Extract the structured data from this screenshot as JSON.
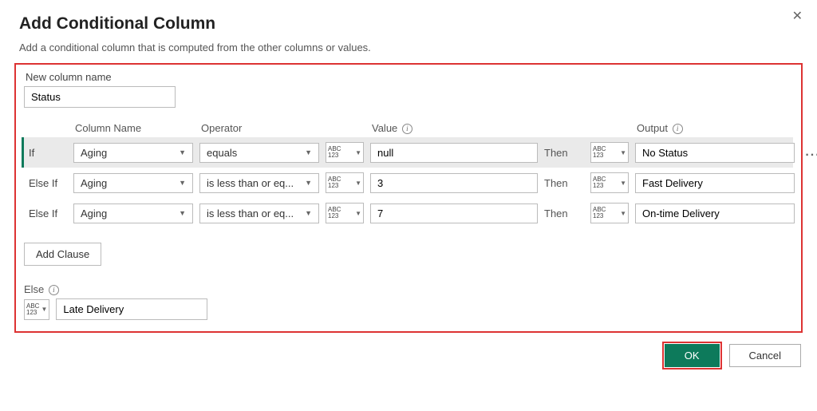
{
  "dialog": {
    "title": "Add Conditional Column",
    "subtitle": "Add a conditional column that is computed from the other columns or values."
  },
  "newColumn": {
    "label": "New column name",
    "value": "Status"
  },
  "headers": {
    "column": "Column Name",
    "operator": "Operator",
    "value": "Value",
    "output": "Output"
  },
  "thenLabel": "Then",
  "typeIcon": "ABC\n123",
  "clauses": [
    {
      "prefix": "If",
      "column": "Aging",
      "operator": "equals",
      "value": "null",
      "output": "No Status",
      "active": true
    },
    {
      "prefix": "Else If",
      "column": "Aging",
      "operator": "is less than or eq...",
      "value": "3",
      "output": "Fast Delivery",
      "active": false
    },
    {
      "prefix": "Else If",
      "column": "Aging",
      "operator": "is less than or eq...",
      "value": "7",
      "output": "On-time Delivery",
      "active": false
    }
  ],
  "addClause": "Add Clause",
  "elseSection": {
    "label": "Else",
    "value": "Late Delivery"
  },
  "buttons": {
    "ok": "OK",
    "cancel": "Cancel"
  }
}
